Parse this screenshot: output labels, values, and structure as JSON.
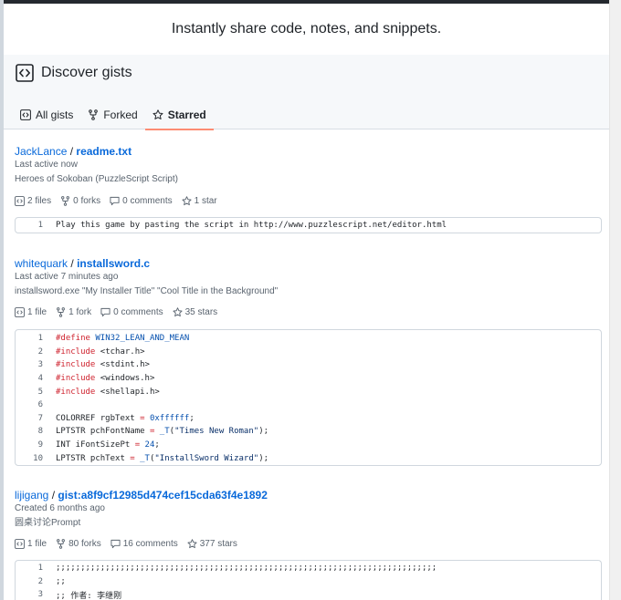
{
  "tagline": "Instantly share code, notes, and snippets.",
  "header": {
    "title": "Discover gists"
  },
  "tabs": [
    {
      "label": "All gists",
      "icon": "code-square-icon"
    },
    {
      "label": "Forked",
      "icon": "repo-forked-icon"
    },
    {
      "label": "Starred",
      "icon": "star-icon",
      "active": true
    }
  ],
  "colors": {
    "link": "#0969da",
    "muted": "#59636e",
    "active_tab_underline": "#fd8c73",
    "keyword": "#cf222e"
  },
  "gists": [
    {
      "owner": "JackLance",
      "separator": "/",
      "filename": "readme.txt",
      "activity": "Last active now",
      "description": "Heroes of Sokoban (PuzzleScript Script)",
      "files": "2 files",
      "forks": "0 forks",
      "comments": "0 comments",
      "stars": "1 star",
      "lines": [
        {
          "n": "1",
          "parts": [
            {
              "t": "Play this game by pasting the script in http://www.puzzlescript.net/editor.html"
            }
          ]
        }
      ]
    },
    {
      "owner": "whitequark",
      "separator": "/",
      "filename": "installsword.c",
      "activity": "Last active 7 minutes ago",
      "description": "installsword.exe \"My Installer Title\" \"Cool Title in the Background\"",
      "files": "1 file",
      "forks": "1 fork",
      "comments": "0 comments",
      "stars": "35 stars",
      "lines": [
        {
          "n": "1",
          "parts": [
            {
              "t": "#define",
              "c": "kw"
            },
            {
              "t": " "
            },
            {
              "t": "WIN32_LEAN_AND_MEAN",
              "c": "nm"
            }
          ]
        },
        {
          "n": "2",
          "parts": [
            {
              "t": "#include",
              "c": "kw"
            },
            {
              "t": " <tchar.h>"
            }
          ]
        },
        {
          "n": "3",
          "parts": [
            {
              "t": "#include",
              "c": "kw"
            },
            {
              "t": " <stdint.h>"
            }
          ]
        },
        {
          "n": "4",
          "parts": [
            {
              "t": "#include",
              "c": "kw"
            },
            {
              "t": " <windows.h>"
            }
          ]
        },
        {
          "n": "5",
          "parts": [
            {
              "t": "#include",
              "c": "kw"
            },
            {
              "t": " <shellapi.h>"
            }
          ]
        },
        {
          "n": "6",
          "parts": [
            {
              "t": ""
            }
          ]
        },
        {
          "n": "7",
          "parts": [
            {
              "t": "COLORREF rgbText "
            },
            {
              "t": "=",
              "c": "kw"
            },
            {
              "t": " "
            },
            {
              "t": "0xffffff",
              "c": "nm"
            },
            {
              "t": ";"
            }
          ]
        },
        {
          "n": "8",
          "parts": [
            {
              "t": "LPTSTR pchFontName "
            },
            {
              "t": "=",
              "c": "kw"
            },
            {
              "t": " "
            },
            {
              "t": "_T",
              "c": "nm"
            },
            {
              "t": "("
            },
            {
              "t": "\"Times New Roman\"",
              "c": "str"
            },
            {
              "t": ");"
            }
          ]
        },
        {
          "n": "9",
          "parts": [
            {
              "t": "INT iFontSizePt "
            },
            {
              "t": "=",
              "c": "kw"
            },
            {
              "t": " "
            },
            {
              "t": "24",
              "c": "nm"
            },
            {
              "t": ";"
            }
          ]
        },
        {
          "n": "10",
          "parts": [
            {
              "t": "LPTSTR pchText "
            },
            {
              "t": "=",
              "c": "kw"
            },
            {
              "t": " "
            },
            {
              "t": "_T",
              "c": "nm"
            },
            {
              "t": "("
            },
            {
              "t": "\"InstallSword Wizard\"",
              "c": "str"
            },
            {
              "t": ");"
            }
          ]
        }
      ]
    },
    {
      "owner": "lijigang",
      "separator": "/",
      "filename": "gist:a8f9cf12985d474cef15cda63f4e1892",
      "activity": "Created 6 months ago",
      "description": "圆桌讨论Prompt",
      "files": "1 file",
      "forks": "80 forks",
      "comments": "16 comments",
      "stars": "377 stars",
      "lines": [
        {
          "n": "1",
          "parts": [
            {
              "t": ";;;;;;;;;;;;;;;;;;;;;;;;;;;;;;;;;;;;;;;;;;;;;;;;;;;;;;;;;;;;;;;;;;;;;;;;;;;;;"
            }
          ]
        },
        {
          "n": "2",
          "parts": [
            {
              "t": ";;"
            }
          ]
        },
        {
          "n": "3",
          "parts": [
            {
              "t": ";; 作者: 李继刚"
            }
          ]
        }
      ]
    }
  ]
}
